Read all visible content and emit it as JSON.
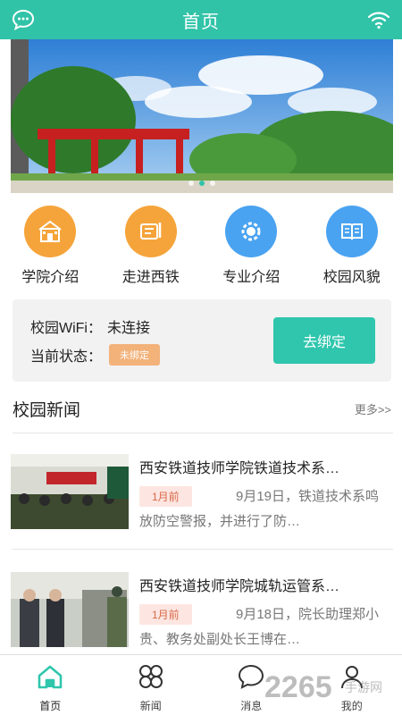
{
  "header": {
    "title": "首页",
    "left_icon": "chat-bubble-icon",
    "right_icon": "wifi-icon"
  },
  "banner": {
    "slides": 3,
    "active_index": 1
  },
  "quicknav": {
    "items": [
      {
        "label": "学院介绍",
        "icon": "school-building-icon",
        "color": "#f5a43b"
      },
      {
        "label": "走进西铁",
        "icon": "document-pen-icon",
        "color": "#f5a43b"
      },
      {
        "label": "专业介绍",
        "icon": "gear-icon",
        "color": "#4aa3f0"
      },
      {
        "label": "校园风貌",
        "icon": "open-book-icon",
        "color": "#4aa3f0"
      }
    ]
  },
  "wifi": {
    "label": "校园WiFi：",
    "value": "未连接",
    "status_label": "当前状态：",
    "status_badge": "未绑定",
    "bind_button": "去绑定"
  },
  "news": {
    "section_title": "校园新闻",
    "more_label": "更多>>",
    "items": [
      {
        "title": "西安铁道技师学院铁道技术系…",
        "date_badge": "1月前",
        "summary": "9月19日，铁道技术系鸣放防空警报，并进行了防…"
      },
      {
        "title": "西安铁道技师学院城轨运管系…",
        "date_badge": "1月前",
        "summary": "9月18日，院长助理郑小贵、教务处副处长王博在…"
      }
    ]
  },
  "tabbar": {
    "items": [
      {
        "label": "首页",
        "icon": "home-icon",
        "active": true
      },
      {
        "label": "新闻",
        "icon": "grid-icon",
        "active": false
      },
      {
        "label": "消息",
        "icon": "message-bubble-icon",
        "active": false
      },
      {
        "label": "我的",
        "icon": "user-icon",
        "active": false
      }
    ]
  },
  "colors": {
    "accent": "#31c3a8",
    "badge": "#f2b27a",
    "date_badge_bg": "#fde6e1"
  },
  "watermark": {
    "text": "2265",
    "sub": "手游网"
  }
}
